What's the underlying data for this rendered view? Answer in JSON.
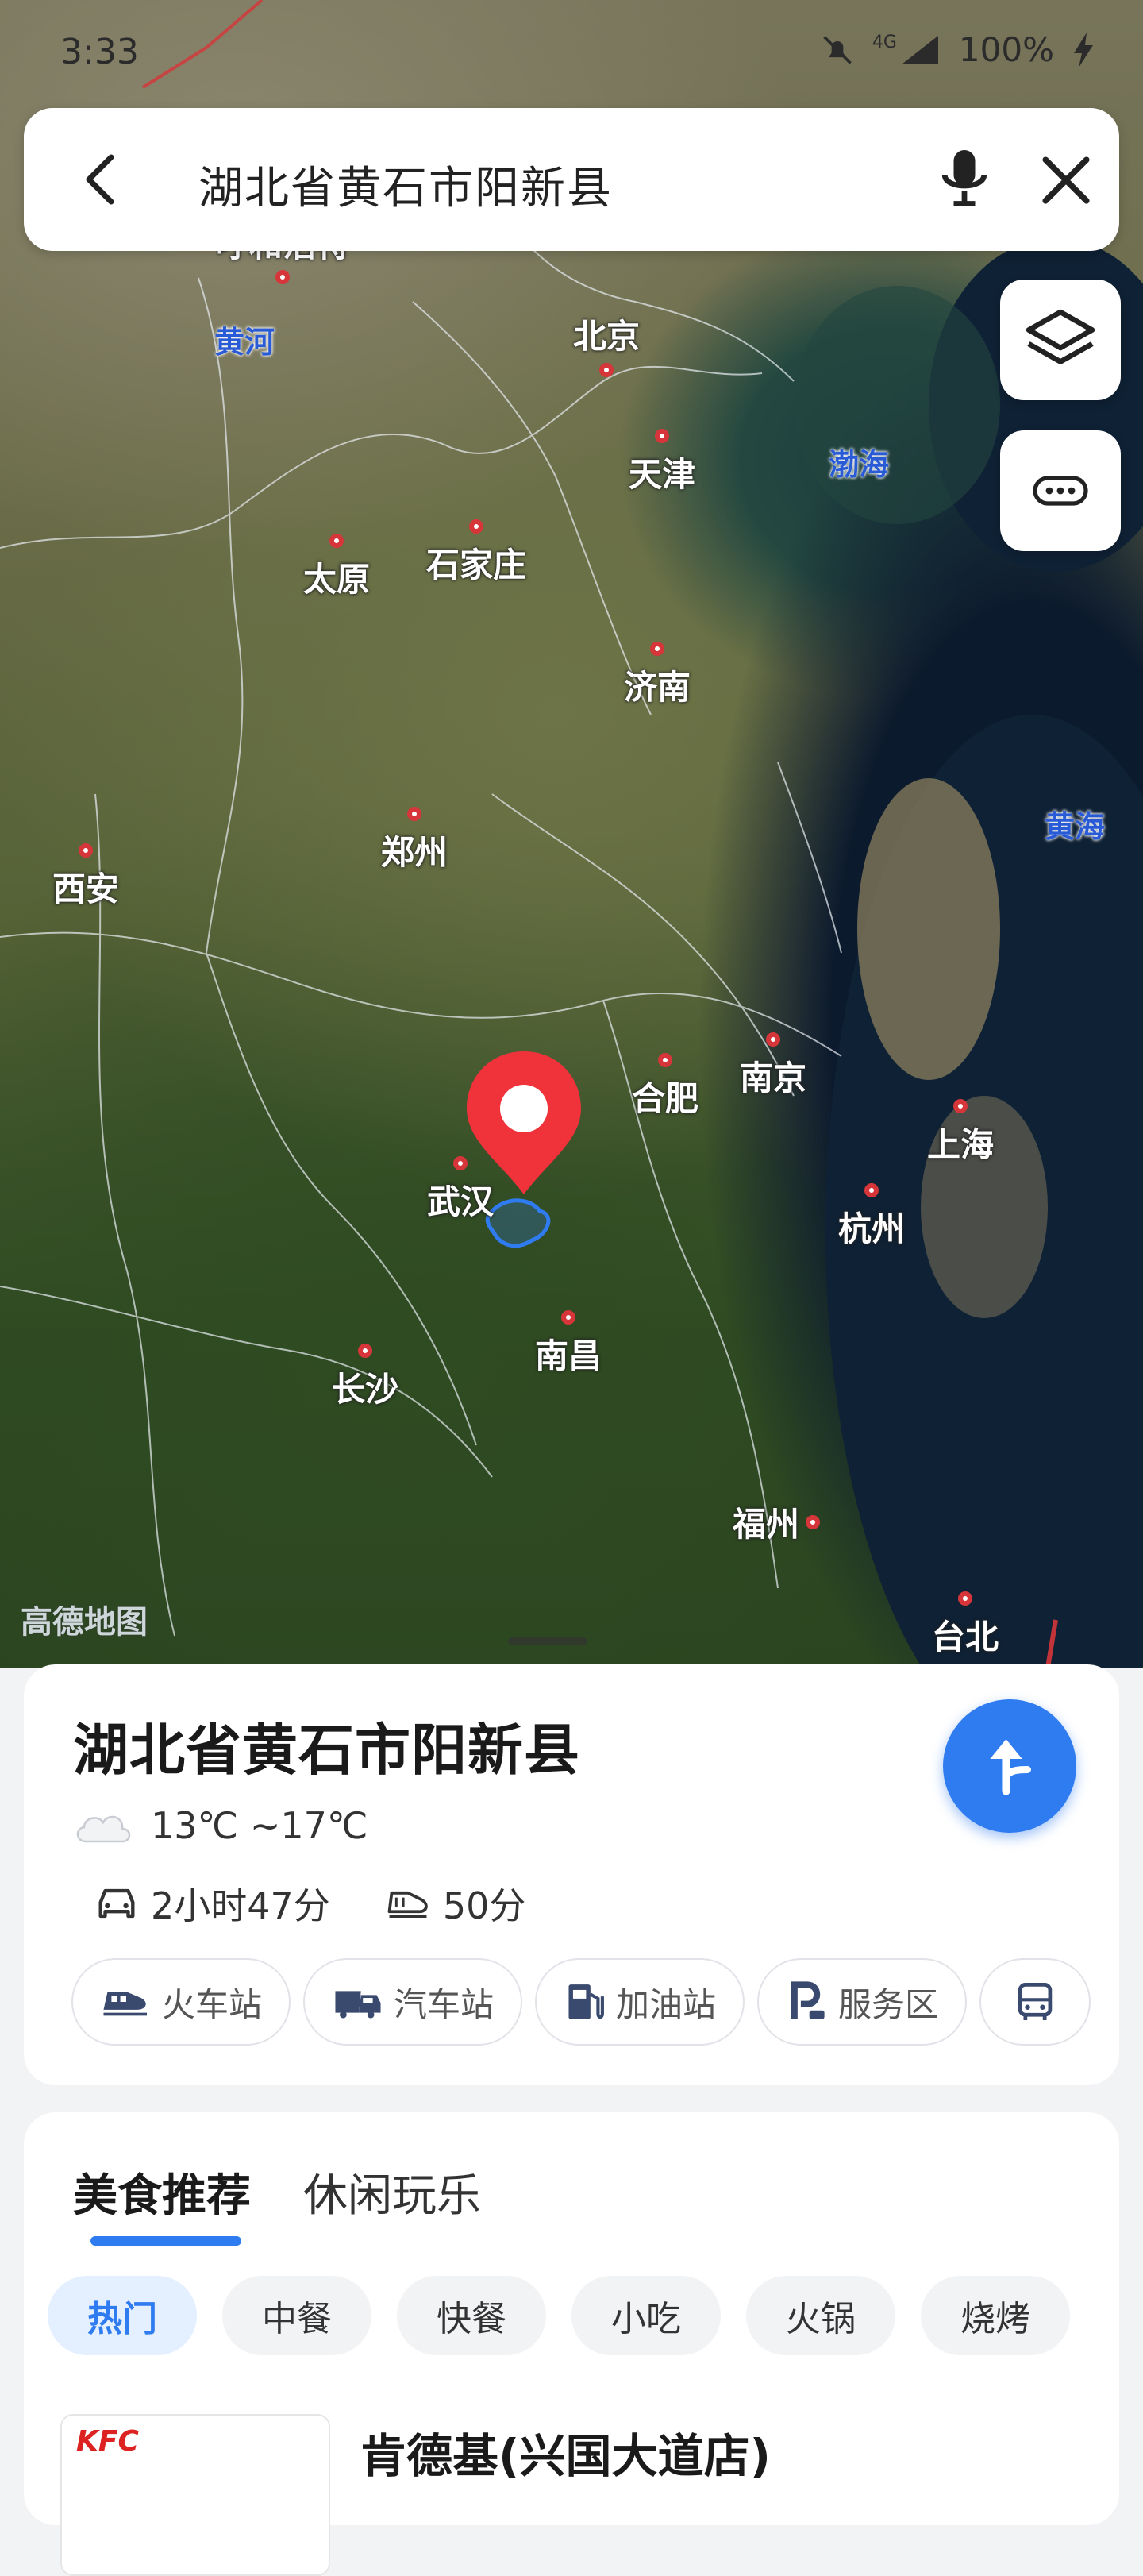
{
  "status_bar": {
    "time": "3:33",
    "network": "4G",
    "battery": "100%"
  },
  "search": {
    "query": "湖北省黄石市阳新县"
  },
  "map": {
    "watermark": "高德地图",
    "cities": [
      {
        "id": "beijing",
        "name": "北京"
      },
      {
        "id": "tianjin",
        "name": "天津"
      },
      {
        "id": "taiyuan",
        "name": "太原"
      },
      {
        "id": "shijiazhuang",
        "name": "石家庄"
      },
      {
        "id": "jinan",
        "name": "济南"
      },
      {
        "id": "zhengzhou",
        "name": "郑州"
      },
      {
        "id": "xian",
        "name": "西安"
      },
      {
        "id": "hefei",
        "name": "合肥"
      },
      {
        "id": "nanjing",
        "name": "南京"
      },
      {
        "id": "shanghai",
        "name": "上海"
      },
      {
        "id": "wuhan",
        "name": "武汉"
      },
      {
        "id": "hangzhou",
        "name": "杭州"
      },
      {
        "id": "nanchang",
        "name": "南昌"
      },
      {
        "id": "changsha",
        "name": "长沙"
      },
      {
        "id": "fuzhou",
        "name": "福州"
      },
      {
        "id": "taibei",
        "name": "台北"
      },
      {
        "id": "top",
        "name": "呼和浩特"
      }
    ],
    "water": {
      "huanghe": "黄河",
      "bohai": "渤海",
      "huanghai": "黄海"
    }
  },
  "place": {
    "title": "湖北省黄石市阳新县",
    "weather": "13℃ ~17℃",
    "drive_time": "2小时47分",
    "train_time": "50分",
    "chips": [
      "火车站",
      "汽车站",
      "加油站",
      "服务区"
    ]
  },
  "recommend": {
    "tabs": [
      "美食推荐",
      "休闲玩乐"
    ],
    "filters": [
      "热门",
      "中餐",
      "快餐",
      "小吃",
      "火锅",
      "烧烤"
    ],
    "poi": {
      "logo": "KFC",
      "name": "肯德基(兴国大道店)"
    }
  },
  "colors": {
    "accent": "#2f7bf0",
    "pin": "#f0333a"
  }
}
